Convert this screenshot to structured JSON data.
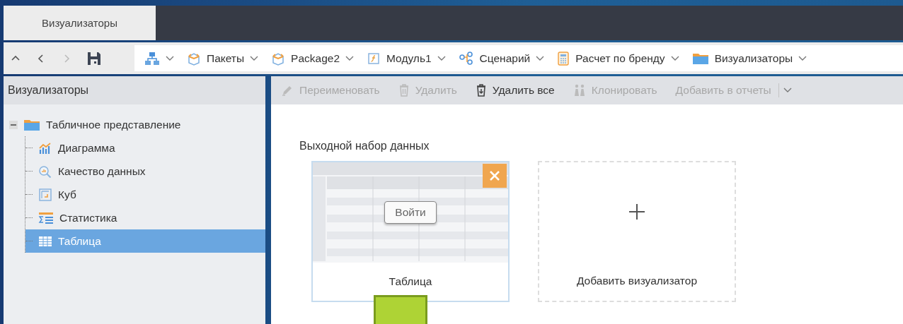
{
  "tabs": [
    {
      "label": "Визуализаторы",
      "selected": true
    }
  ],
  "nav": {
    "buttons": [
      {
        "kind": "up",
        "disabled": false
      },
      {
        "kind": "back",
        "disabled": false
      },
      {
        "kind": "forward",
        "disabled": true
      },
      {
        "kind": "save",
        "disabled": false
      }
    ]
  },
  "breadcrumbs": [
    {
      "kind": "hierarchy"
    },
    {
      "kind": "package",
      "label": "Пакеты"
    },
    {
      "kind": "package",
      "label": "Package2"
    },
    {
      "kind": "module",
      "label": "Модуль1"
    },
    {
      "kind": "scenario",
      "label": "Сценарий"
    },
    {
      "kind": "calculator",
      "label": "Расчет по бренду"
    },
    {
      "kind": "folder",
      "label": "Визуализаторы"
    }
  ],
  "sidebar": {
    "title": "Визуализаторы",
    "tree": [
      {
        "kind": "folder",
        "label": "Табличное представление",
        "expanded": true,
        "selected": false,
        "children": [
          {
            "kind": "chart",
            "label": "Диаграмма",
            "selected": false
          },
          {
            "kind": "quality",
            "label": "Качество данных",
            "selected": false
          },
          {
            "kind": "cube",
            "label": "Куб",
            "selected": false
          },
          {
            "kind": "stats",
            "label": "Статистика",
            "selected": false
          },
          {
            "kind": "table",
            "label": "Таблица",
            "selected": true
          }
        ]
      }
    ]
  },
  "toolbar": [
    {
      "kind": "rename",
      "label": "Переименовать",
      "disabled": true
    },
    {
      "kind": "delete",
      "label": "Удалить",
      "disabled": true
    },
    {
      "kind": "delete-all",
      "label": "Удалить все",
      "disabled": false
    },
    {
      "kind": "clone",
      "label": "Клонировать",
      "disabled": true
    },
    {
      "kind": "add-report",
      "label": "Добавить в отчеты",
      "disabled": true
    }
  ],
  "content": {
    "title": "Выходной набор данных",
    "cards": [
      {
        "kind": "visualizer",
        "label": "Таблица",
        "button": "Войти"
      },
      {
        "kind": "add",
        "label": "Добавить визуализатор"
      }
    ]
  }
}
